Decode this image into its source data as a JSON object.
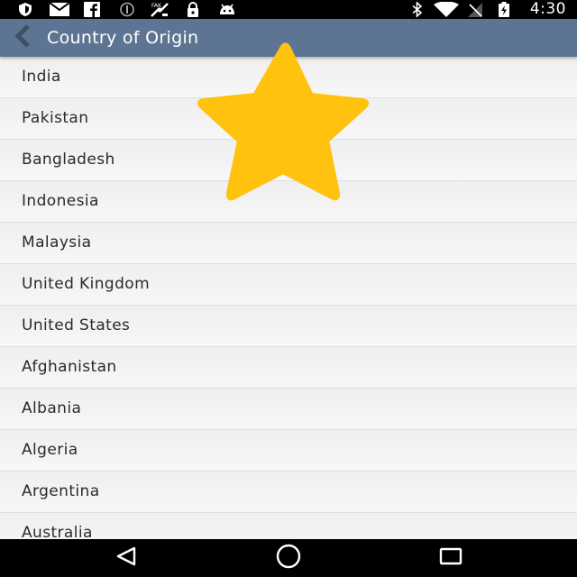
{
  "status_bar": {
    "time": "4:30",
    "left_icons": [
      "shield-icon",
      "mail-icon",
      "facebook-icon",
      "circle-icon",
      "fake-gps-icon",
      "lock-icon",
      "android-icon"
    ],
    "right_icons": [
      "bluetooth-icon",
      "wifi-icon",
      "no-signal-icon",
      "battery-icon"
    ]
  },
  "app_bar": {
    "title": "Country of Origin",
    "back_icon": "chevron-left-icon",
    "background": "#5d7592"
  },
  "countries": [
    {
      "label": "India"
    },
    {
      "label": "Pakistan"
    },
    {
      "label": "Bangladesh"
    },
    {
      "label": "Indonesia"
    },
    {
      "label": "Malaysia"
    },
    {
      "label": "United Kingdom"
    },
    {
      "label": "United States"
    },
    {
      "label": "Afghanistan"
    },
    {
      "label": "Albania"
    },
    {
      "label": "Algeria"
    },
    {
      "label": "Argentina"
    },
    {
      "label": "Australia"
    }
  ],
  "overlay": {
    "icon": "star-icon",
    "color": "#ffc20e"
  },
  "nav_bar": {
    "icons": [
      "back-triangle-icon",
      "home-circle-icon",
      "recents-square-icon"
    ]
  }
}
